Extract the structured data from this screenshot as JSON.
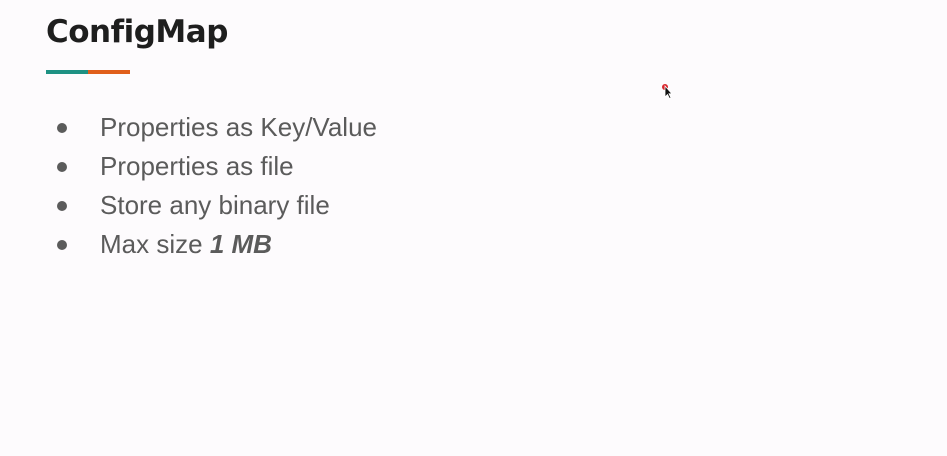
{
  "slide": {
    "title": "ConfigMap",
    "underline_colors": [
      "#1e9183",
      "#e05e1a"
    ],
    "bullets": [
      {
        "text": "Properties as Key/Value",
        "emphasis": ""
      },
      {
        "text": "Properties as file",
        "emphasis": ""
      },
      {
        "text": "Store any binary file",
        "emphasis": ""
      },
      {
        "text": "Max size ",
        "emphasis": "1 MB"
      }
    ]
  },
  "cursor": {
    "icon": "mouse-pointer-icon",
    "dot_color": "#d9262c"
  }
}
